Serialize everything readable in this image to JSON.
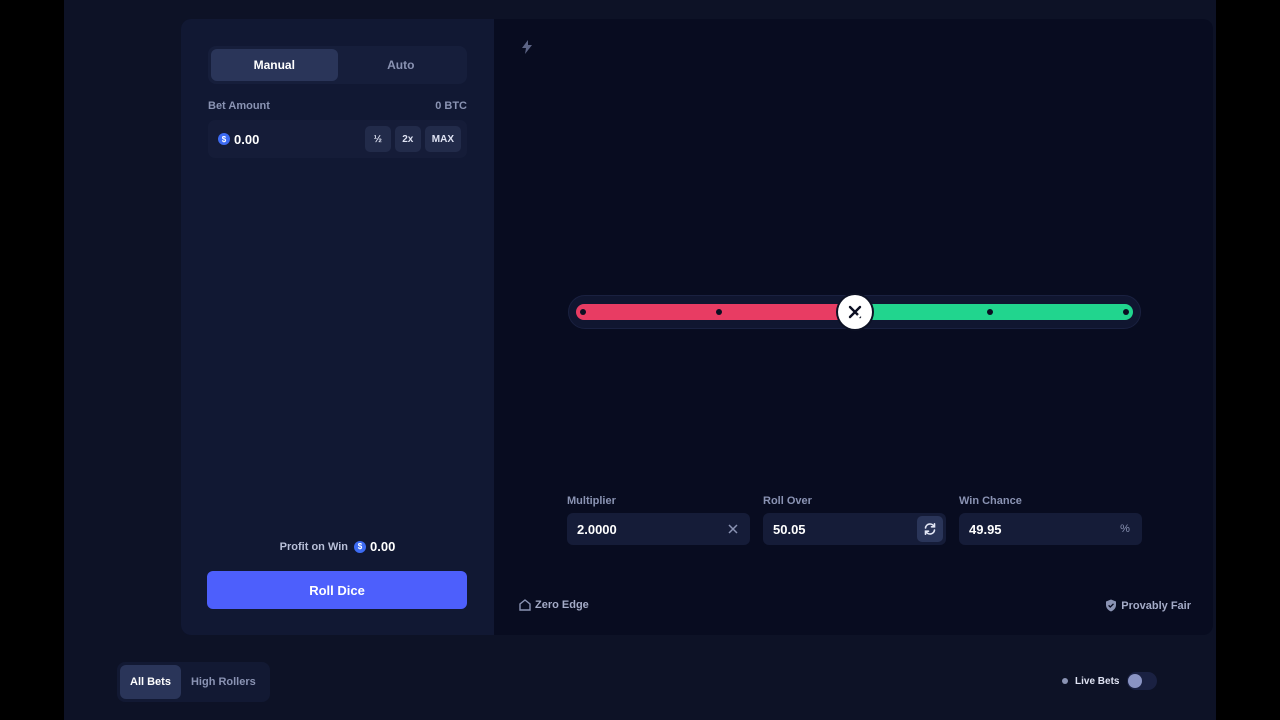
{
  "colors": {
    "lose": "#e83c63",
    "win": "#21d58e",
    "accent": "#4d5ffc",
    "coin": "#3d6bf2"
  },
  "tabs": {
    "manual": "Manual",
    "auto": "Auto",
    "active": "Manual"
  },
  "bet": {
    "label": "Bet Amount",
    "balance": "0 BTC",
    "currency_symbol": "$",
    "value": "0.00",
    "half": "½",
    "double": "2x",
    "max": "MAX"
  },
  "profit": {
    "label": "Profit on Win",
    "currency_symbol": "$",
    "value": "0.00"
  },
  "roll_button": "Roll Dice",
  "slider": {
    "value": 50.05,
    "min": 0,
    "max": 100,
    "marks": [
      0,
      25,
      50,
      75,
      100
    ],
    "handle_icon": "dice-icon"
  },
  "fields": {
    "multiplier": {
      "label": "Multiplier",
      "value": "2.0000",
      "icon": "x-icon"
    },
    "roll_over": {
      "label": "Roll Over",
      "value": "50.05",
      "icon": "swap-arrows-icon"
    },
    "win_chance": {
      "label": "Win Chance",
      "value": "49.95",
      "icon": "percent-icon",
      "suffix": "%"
    }
  },
  "footer": {
    "zero_edge": "Zero Edge",
    "provably_fair": "Provably Fair"
  },
  "bets": {
    "all": "All Bets",
    "high_rollers": "High Rollers",
    "active": "All Bets",
    "live_label": "Live Bets",
    "live_enabled": false
  }
}
